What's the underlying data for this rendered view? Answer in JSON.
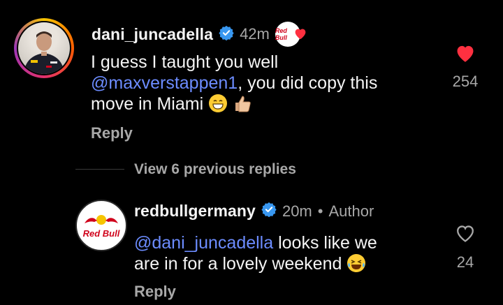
{
  "comment": {
    "username": "dani_juncadella",
    "time": "42m",
    "text_line1": "I guess I taught you well",
    "mention": "@maxverstappen1",
    "text_line2_rest": ", you did copy this",
    "text_line3": "move in Miami",
    "reply_label": "Reply",
    "like_count": "254",
    "creator_badge_text": "Red Bull"
  },
  "thread": {
    "view_replies_label": "View 6 previous replies"
  },
  "reply": {
    "username": "redbullgermany",
    "time": "20m",
    "separator": "•",
    "author_label": "Author",
    "mention": "@dani_juncadella",
    "text_line1_rest": " looks like we",
    "text_line2": "are in for a lovely weekend",
    "reply_label": "Reply",
    "like_count": "24",
    "avatar_text": "Red Bull"
  },
  "colors": {
    "background": "#000000",
    "mention": "#6c8cff",
    "verified": "#3897f0",
    "liked_heart": "#ff3040",
    "muted": "#a8a8a8"
  },
  "icons": {
    "verified": "verified-badge-icon",
    "heart_filled": "heart-filled-icon",
    "heart_outline": "heart-outline-icon"
  }
}
